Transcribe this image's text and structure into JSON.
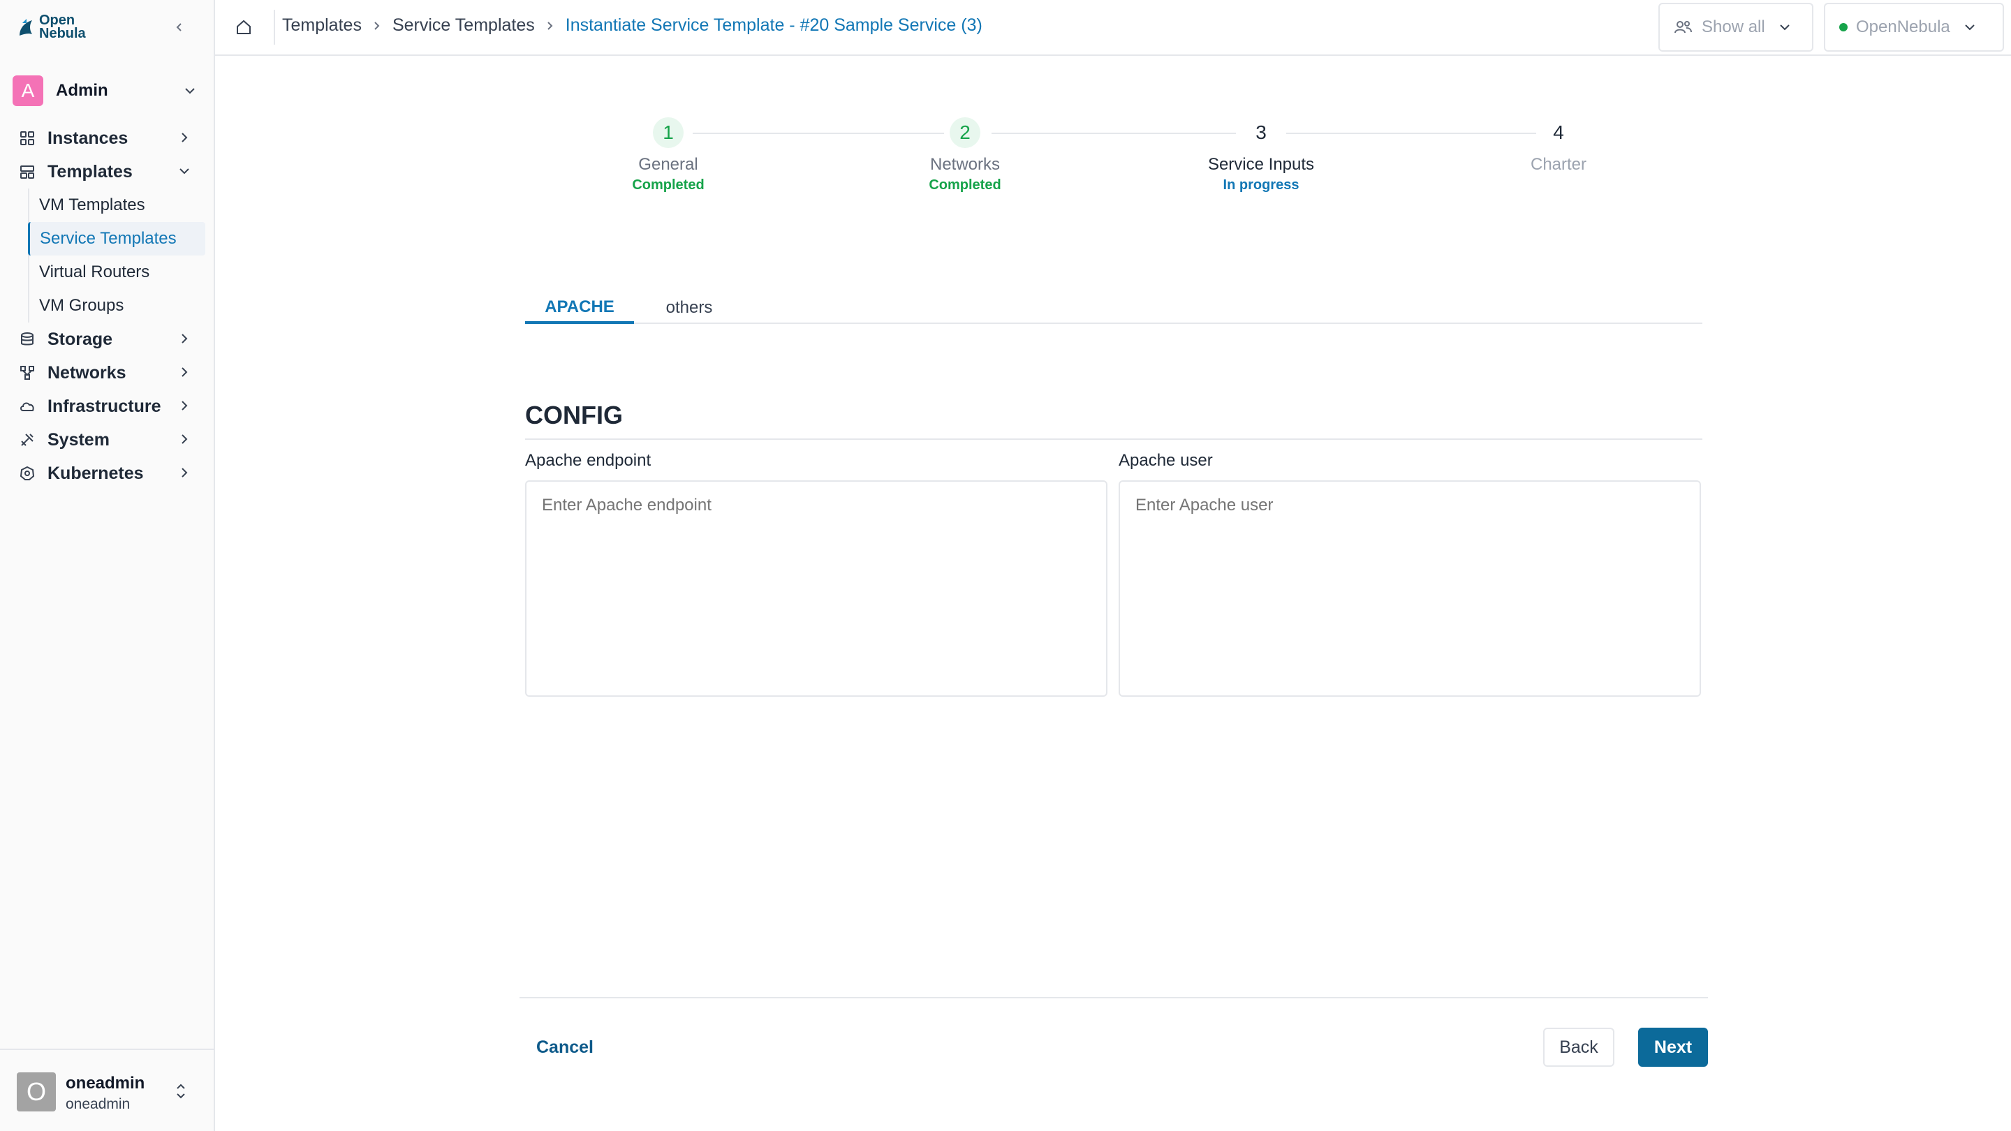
{
  "app": {
    "logo_line1": "Open",
    "logo_line2": "Nebula",
    "brand_color": "#1277b5"
  },
  "sidebar": {
    "group": {
      "avatar_letter": "A",
      "name": "Admin"
    },
    "items": [
      {
        "label": "Instances",
        "icon": "grid-icon"
      },
      {
        "label": "Templates",
        "icon": "template-icon",
        "expanded": true,
        "children": [
          "VM Templates",
          "Service Templates",
          "Virtual Routers",
          "VM Groups"
        ],
        "active_child": "Service Templates"
      },
      {
        "label": "Storage",
        "icon": "database-icon"
      },
      {
        "label": "Networks",
        "icon": "network-icon"
      },
      {
        "label": "Infrastructure",
        "icon": "cloud-icon"
      },
      {
        "label": "System",
        "icon": "tools-icon"
      },
      {
        "label": "Kubernetes",
        "icon": "kubernetes-icon"
      }
    ],
    "user": {
      "avatar_letter": "O",
      "name": "oneadmin",
      "group": "oneadmin"
    }
  },
  "topbar": {
    "breadcrumb": [
      "Templates",
      "Service Templates",
      "Instantiate Service Template - #20 Sample Service (3)"
    ],
    "filter_label": "Show all",
    "zone_label": "OpenNebula"
  },
  "stepper": {
    "steps": [
      {
        "number": "1",
        "label": "General",
        "status": "Completed"
      },
      {
        "number": "2",
        "label": "Networks",
        "status": "Completed"
      },
      {
        "number": "3",
        "label": "Service Inputs",
        "status": "In progress"
      },
      {
        "number": "4",
        "label": "Charter",
        "status": ""
      }
    ]
  },
  "tabs": [
    "APACHE",
    "others"
  ],
  "section": {
    "title": "CONFIG",
    "fields": [
      {
        "label": "Apache endpoint",
        "placeholder": "Enter Apache endpoint",
        "value": ""
      },
      {
        "label": "Apache user",
        "placeholder": "Enter Apache user",
        "value": ""
      }
    ]
  },
  "footer": {
    "cancel_label": "Cancel",
    "back_label": "Back",
    "next_label": "Next"
  }
}
